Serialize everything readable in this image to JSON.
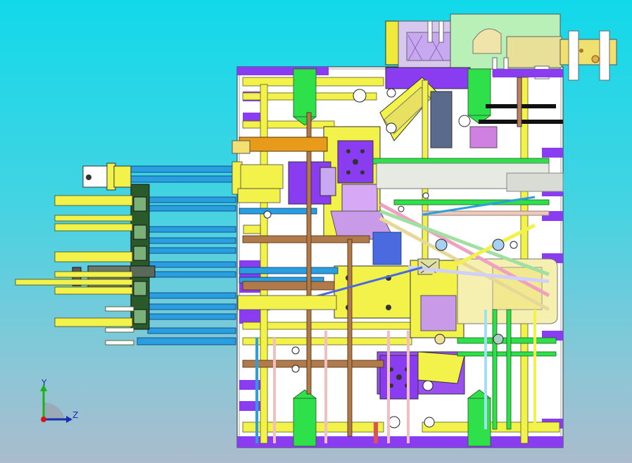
{
  "viewport": {
    "background_top": "#12d9ea",
    "background_bottom": "#aabccd"
  },
  "triad": {
    "y_label": "Y",
    "z_label": "Z",
    "y_color": "#1bb21b",
    "z_color": "#1a2fb0",
    "x_color": "#d11818"
  },
  "model": {
    "icon": "cad-assembly-wireframe",
    "colors": {
      "frame_purple": "#8a3cf0",
      "pipe_yellow": "#f2f24a",
      "pipe_blue": "#2a9fe0",
      "pipe_green": "#2ee04a",
      "pipe_orange": "#e89a1a",
      "pipe_tan": "#b07a4a",
      "body_lilac": "#c89ae8"
    }
  }
}
